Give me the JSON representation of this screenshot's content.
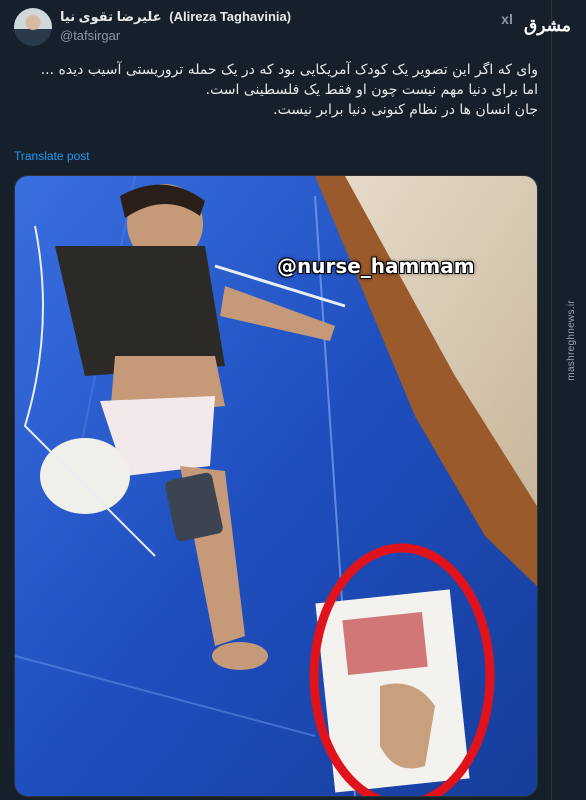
{
  "author": {
    "display_name_fa": "علیرضا تقوی نیا",
    "display_name_en": "(Alireza Taghavinia)",
    "handle": "@tafsirgar"
  },
  "header": {
    "grok_label": "x͏l",
    "logo_text": "مشرق"
  },
  "tweet": {
    "lines": [
      "وای که اگر این تصویر یک کودک آمریکایی بود که در یک حمله تروریستی آسیب دیده ...",
      "اما برای دنیا مهم نیست چون او فقط یک فلسطینی است.",
      "جان انسان ها در نظام کنونی دنیا برابر نیست."
    ],
    "translate_label": "Translate post"
  },
  "media": {
    "overlay_text": "@nurse_hammam",
    "colors": {
      "tarp": "#1f4fbf",
      "circle": "#e0131c",
      "wall": "#d9cbb4"
    }
  },
  "watermark": {
    "text": "mashreghnews.ir"
  }
}
